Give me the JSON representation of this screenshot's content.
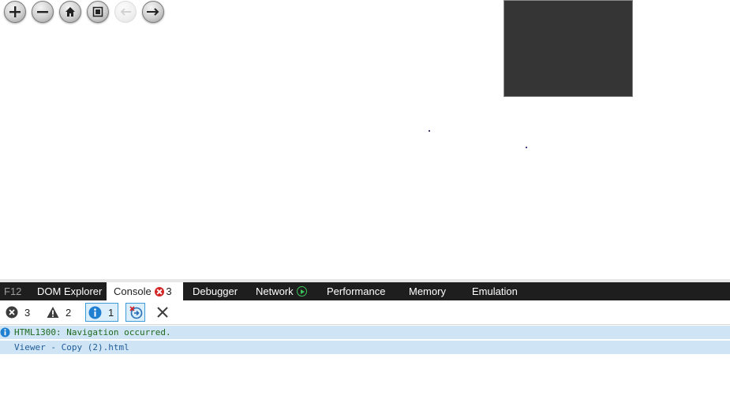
{
  "toolbar": {
    "buttons": [
      {
        "name": "zoom-in",
        "icon": "plus-icon"
      },
      {
        "name": "zoom-out",
        "icon": "minus-icon"
      },
      {
        "name": "home",
        "icon": "home-icon"
      },
      {
        "name": "full-page",
        "icon": "fullscreen-icon"
      },
      {
        "name": "previous",
        "icon": "arrow-left-icon",
        "disabled": true
      },
      {
        "name": "next",
        "icon": "arrow-right-icon"
      }
    ]
  },
  "devtools": {
    "tabs": {
      "f12": "F12",
      "dom": "DOM Explorer",
      "console": "Console",
      "console_errors": "3",
      "debugger": "Debugger",
      "network": "Network",
      "performance": "Performance",
      "memory": "Memory",
      "emulation": "Emulation"
    },
    "filters": {
      "errors": "3",
      "warnings": "2",
      "messages": "1"
    },
    "log": [
      {
        "message": "HTML1300: Navigation occurred."
      },
      {
        "source": "Viewer - Copy (2).html"
      }
    ]
  },
  "colors": {
    "tab_bar": "#1e1e1e",
    "log_row": "#cfe5f5",
    "navigator": "#353535",
    "error": "#d32424",
    "info": "#1f7fd1"
  }
}
